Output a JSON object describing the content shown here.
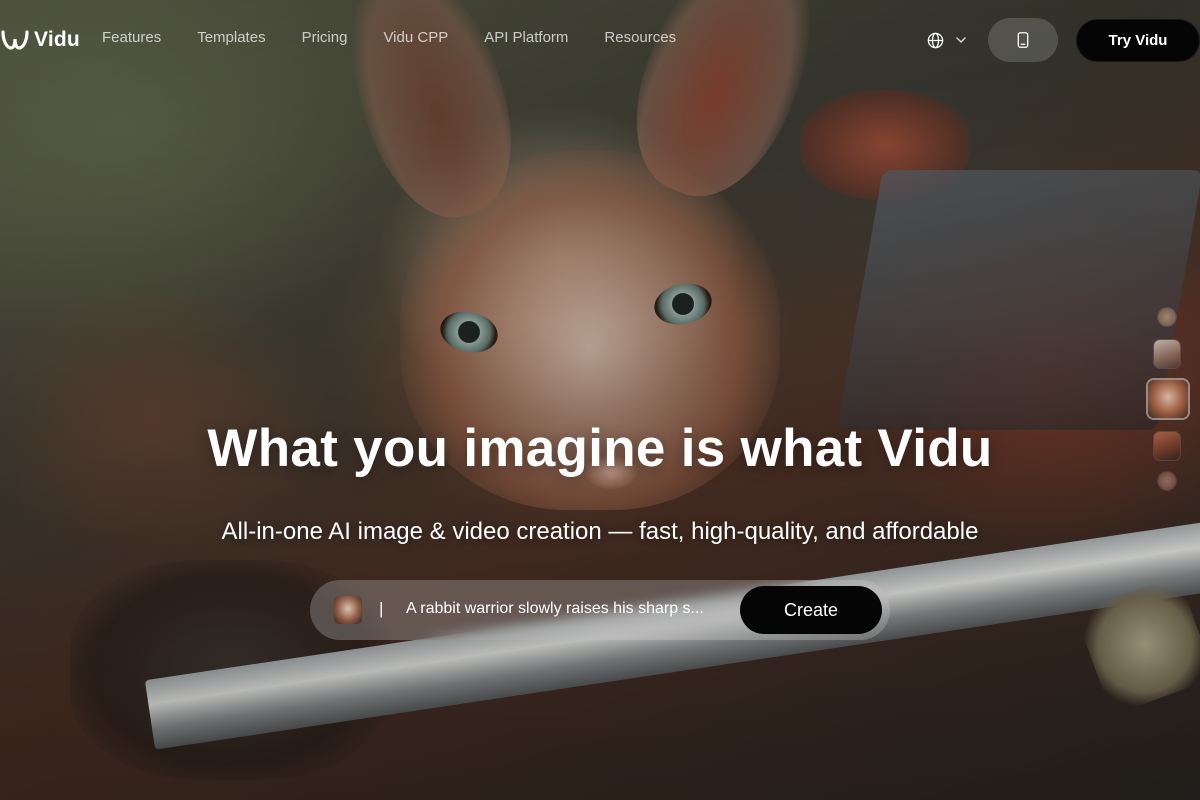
{
  "header": {
    "brand": "Vidu",
    "nav": [
      {
        "label": "Features"
      },
      {
        "label": "Templates"
      },
      {
        "label": "Pricing"
      },
      {
        "label": "Vidu CPP"
      },
      {
        "label": "API Platform"
      },
      {
        "label": "Resources"
      }
    ],
    "language_icon": "globe-icon",
    "language_chevron_icon": "chevron-down-icon",
    "mobile_icon": "mobile-phone-icon",
    "try_label": "Try Vidu"
  },
  "hero": {
    "title": "What you imagine is what Vidu",
    "subtitle": "All-in-one AI image & video creation — fast, high-quality, and affordable",
    "prompt": {
      "separator": "|",
      "text": "A rabbit warrior slowly raises his sharp s...",
      "create_label": "Create"
    }
  },
  "carousel": {
    "thumbnails": 5,
    "active_index": 2
  },
  "colors": {
    "button_bg": "#050505",
    "text": "#ffffff",
    "nav_text": "rgba(255,255,255,0.72)"
  }
}
